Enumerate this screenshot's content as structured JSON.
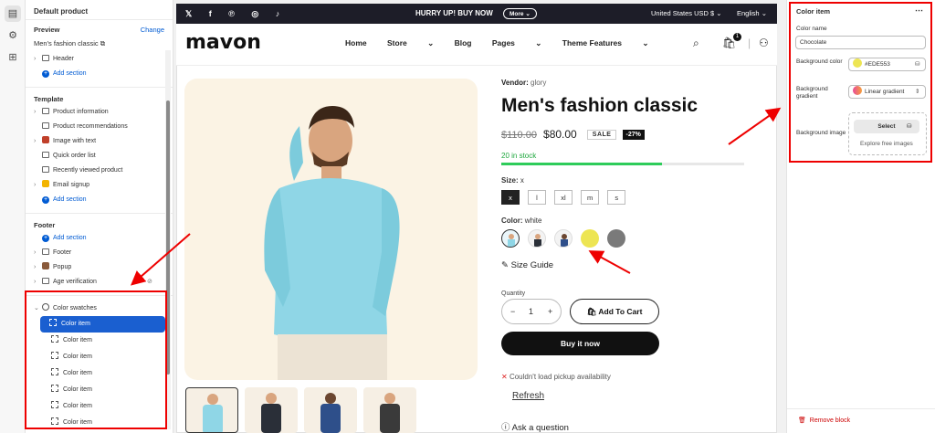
{
  "left_panel": {
    "header": "Default product",
    "preview_label": "Preview",
    "change_label": "Change",
    "product_name": "Men's fashion classic",
    "header_section": "Header",
    "add_section": "Add section",
    "template_title": "Template",
    "template_items": [
      "Product information",
      "Product recommendations",
      "Image with text",
      "Quick order list",
      "Recently viewed product",
      "Email signup"
    ],
    "footer_title": "Footer",
    "footer_items": [
      "Footer",
      "Popup",
      "Age verification"
    ],
    "color_swatches": "Color swatches",
    "color_items": [
      "Color item",
      "Color item",
      "Color item",
      "Color item",
      "Color item",
      "Color item",
      "Color item"
    ]
  },
  "announcement": {
    "hurry": "HURRY UP! BUY NOW",
    "more": "More",
    "currency": "United States USD $",
    "language": "English"
  },
  "nav": {
    "logo": "mavon",
    "items": [
      "Home",
      "Store",
      "Blog",
      "Pages",
      "Theme Features"
    ],
    "cart_count": "1"
  },
  "product": {
    "vendor_label": "Vendor:",
    "vendor": "glory",
    "title": "Men's fashion classic",
    "old_price": "$110.00",
    "price": "$80.00",
    "sale": "SALE",
    "discount": "-27%",
    "stock": "20 in stock",
    "stock_fraction": 0.66,
    "size_label": "Size:",
    "size_value": "x",
    "sizes": [
      "x",
      "l",
      "xl",
      "m",
      "s"
    ],
    "color_label": "Color:",
    "color_value": "white",
    "size_guide": "Size Guide",
    "quantity_label": "Quantity",
    "quantity": "1",
    "add_to_cart": "Add To Cart",
    "buy_now": "Buy it now",
    "pickup": "Couldn't load pickup availability",
    "refresh": "Refresh",
    "ask": "Ask a question"
  },
  "right_panel": {
    "title": "Color item",
    "color_name_label": "Color name",
    "color_name": "Chocolate",
    "bg_color_label": "Background color",
    "bg_color": "#EDE553",
    "bg_gradient_label": "Background gradient",
    "bg_gradient": "Linear gradient",
    "bg_image_label": "Background image",
    "select": "Select",
    "explore": "Explore free images",
    "remove": "Remove block"
  },
  "colors": {
    "accent": "#005bd3",
    "selected": "#1a5fd0",
    "swatch_yellow": "#EDE553",
    "swatch_gray": "#7a7a7a",
    "annotation_red": "#e00000"
  }
}
